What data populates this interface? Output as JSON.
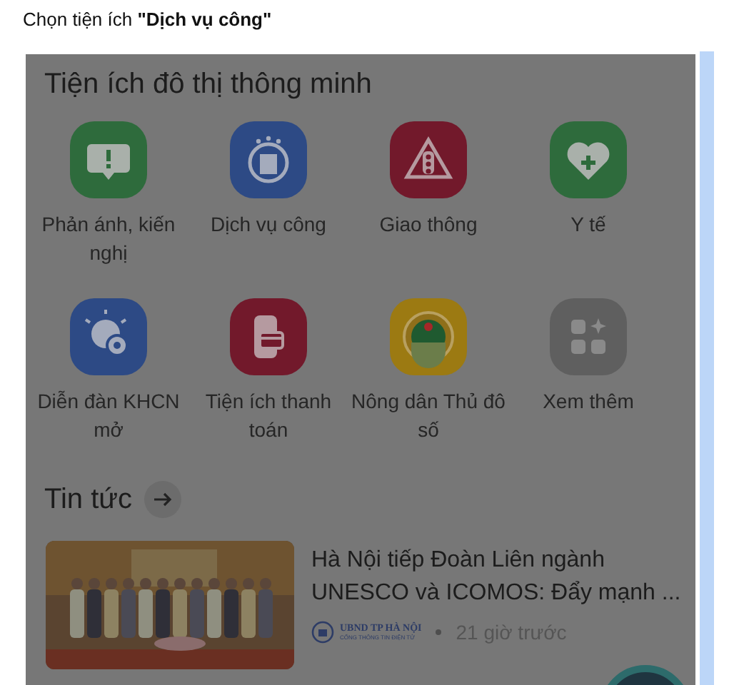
{
  "caption": "Chọn tiện ích **\"Dịch vụ công\"**",
  "utilities": {
    "title": "Tiện ích đô thị thông minh",
    "items": [
      {
        "label": "Phản ánh, kiến nghị",
        "kind": "feedback",
        "color": "#2e6b3c"
      },
      {
        "label": "Dịch vụ công",
        "kind": "emblem",
        "color": "#2d4a85"
      },
      {
        "label": "Giao thông",
        "kind": "traffic",
        "color": "#72192b"
      },
      {
        "label": "Y tế",
        "kind": "health",
        "color": "#2e6b3c"
      },
      {
        "label": "Diễn đàn KHCN mở",
        "kind": "idea",
        "color": "#2d4a85"
      },
      {
        "label": "Tiện ích thanh toán",
        "kind": "payment",
        "color": "#72192b"
      },
      {
        "label": "Nông dân Thủ đô số",
        "kind": "farmer",
        "color": "#9c7a12"
      },
      {
        "label": "Xem thêm",
        "kind": "more",
        "color": "#5f5f5f"
      }
    ]
  },
  "news": {
    "title": "Tin tức",
    "items": [
      {
        "title": "Hà Nội tiếp Đoàn Liên ngành UNESCO và ICOMOS: Đẩy mạnh ...",
        "source": "UBND TP HÀ NỘI",
        "source_subtitle": "CỔNG THÔNG TIN ĐIỆN TỬ",
        "time": "21 giờ trước"
      }
    ]
  }
}
